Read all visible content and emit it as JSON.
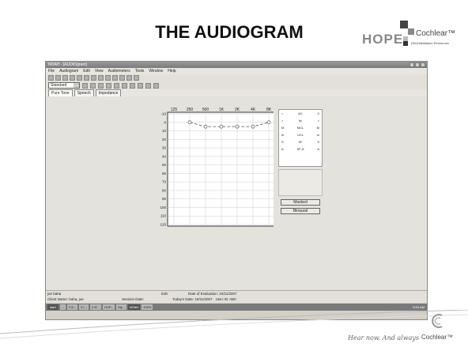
{
  "slide": {
    "title": "THE AUDIOGRAM",
    "logo_hope": "HOPE",
    "logo_cochlear": "Cochlear™",
    "logo_rehab": "(Re)Habilitation Resources",
    "tagline": "Hear now. And always",
    "footer_brand": "Cochlear™"
  },
  "window": {
    "title": "NOAH - [AUDIOgram]",
    "menu": [
      "File",
      "Audiogram",
      "Edit",
      "View",
      "Audiometers",
      "Tools",
      "Window",
      "Help"
    ],
    "preset_select": "Standard",
    "tabs": [
      "Pure Tone",
      "Speech",
      "Impedance"
    ]
  },
  "legend": {
    "rows": [
      [
        "AC",
        "X"
      ],
      [
        "bc",
        ">"
      ],
      [
        "MCL",
        "M"
      ],
      [
        "UCL",
        "m"
      ],
      [
        "SF",
        "S"
      ],
      [
        "SF-A",
        "A"
      ]
    ]
  },
  "buttons": {
    "masked": "Masked",
    "binaural": "Binaural"
  },
  "status": {
    "patient": "joe baha",
    "mode": "Edit",
    "eval_date": "Date of Evaluation: 10/11/2007",
    "client": "Client Name: baha, joe",
    "session": "Session Date:",
    "today": "Today's Date: 10/11/2007",
    "user": "User ID: ABC"
  },
  "taskbar": {
    "start": "start",
    "items": [
      "...",
      "Fol...",
      "3 I...",
      "2 M...",
      "HOP...",
      "My...",
      "NOAH",
      "100%"
    ],
    "clock": "8:54 AM"
  },
  "chart_data": {
    "type": "line",
    "x": [
      "125",
      "250",
      "500",
      "1K",
      "2K",
      "4K",
      "8K"
    ],
    "y_ticks": [
      -10,
      0,
      10,
      20,
      30,
      40,
      50,
      60,
      70,
      80,
      90,
      100,
      110,
      120
    ],
    "ylim": [
      -10,
      120
    ],
    "y_inverted": true,
    "grid": true,
    "series": [
      {
        "values": [
          null,
          0,
          5,
          5,
          5,
          5,
          0
        ]
      }
    ]
  }
}
